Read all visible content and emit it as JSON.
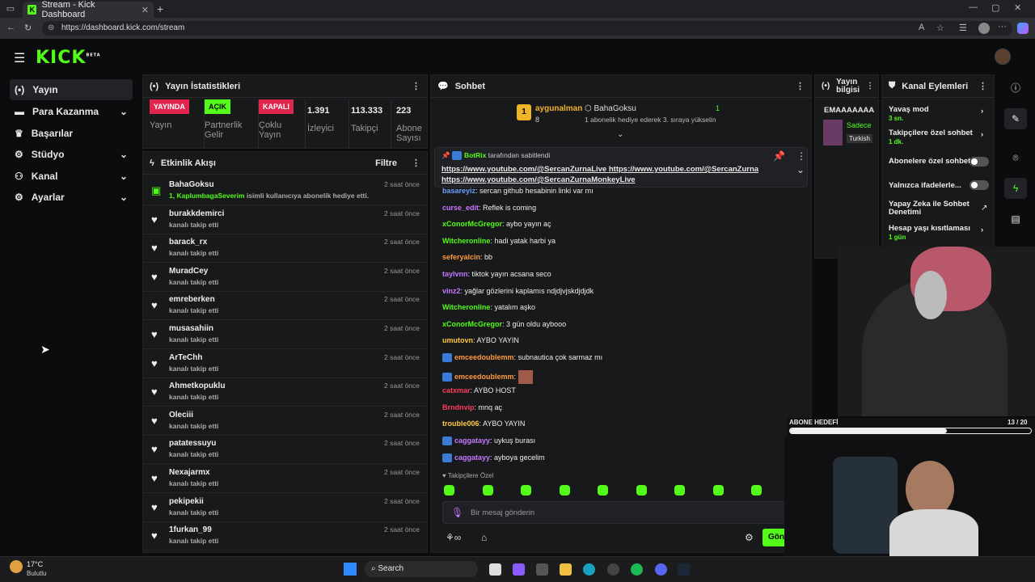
{
  "browser": {
    "tab_title": "Stream - Kick Dashboard",
    "url": "https://dashboard.kick.com/stream"
  },
  "logo": {
    "text": "KICK",
    "beta": "BETA"
  },
  "sidebar": {
    "items": [
      {
        "label": "Yayın",
        "icon": "stream-icon",
        "active": true
      },
      {
        "label": "Para Kazanma",
        "icon": "money-icon",
        "chevron": true
      },
      {
        "label": "Başarılar",
        "icon": "trophy-icon"
      },
      {
        "label": "Stüdyo",
        "icon": "gear-icon",
        "chevron": true
      },
      {
        "label": "Kanal",
        "icon": "users-icon",
        "chevron": true
      },
      {
        "label": "Ayarlar",
        "icon": "settings-icon",
        "chevron": true
      }
    ]
  },
  "stats": {
    "title": "Yayın İstatistikleri",
    "items": [
      {
        "pill": "YAYINDA",
        "label": "Yayın"
      },
      {
        "pill": "AÇIK",
        "label": "Partnerlik Gelir"
      },
      {
        "pill": "KAPALI",
        "label": "Çoklu Yayın"
      },
      {
        "value": "1.391",
        "label": "İzleyici"
      },
      {
        "value": "113.333",
        "label": "Takipçi"
      },
      {
        "value": "223",
        "label": "Abone Sayısı"
      }
    ]
  },
  "activity": {
    "title": "Etkinlik Akışı",
    "filter": "Filtre",
    "rows": [
      {
        "name": "BahaGoksu",
        "prefix": "1, KaplumbagaSeverim",
        "sub": " isimli kullanıcıya abonelik hediye etti.",
        "time": "2 saat önce",
        "gift": true
      },
      {
        "name": "burakkdemirci",
        "sub": "kanalı takip etti",
        "time": "2 saat önce"
      },
      {
        "name": "barack_rx",
        "sub": "kanalı takip etti",
        "time": "2 saat önce"
      },
      {
        "name": "MuradCey",
        "sub": "kanalı takip etti",
        "time": "2 saat önce"
      },
      {
        "name": "emreberken",
        "sub": "kanalı takip etti",
        "time": "2 saat önce"
      },
      {
        "name": "musasahiin",
        "sub": "kanalı takip etti",
        "time": "2 saat önce"
      },
      {
        "name": "ArTeChh",
        "sub": "kanalı takip etti",
        "time": "2 saat önce"
      },
      {
        "name": "Ahmetkopuklu",
        "sub": "kanalı takip etti",
        "time": "2 saat önce"
      },
      {
        "name": "Oleciii",
        "sub": "kanalı takip etti",
        "time": "2 saat önce"
      },
      {
        "name": "patatessuyu",
        "sub": "kanalı takip etti",
        "time": "2 saat önce"
      },
      {
        "name": "Nexajarmx",
        "sub": "kanalı takip etti",
        "time": "2 saat önce"
      },
      {
        "name": "pekipekii",
        "sub": "kanalı takip etti",
        "time": "2 saat önce"
      },
      {
        "name": "1furkan_99",
        "sub": "kanalı takip etti",
        "time": "2 saat önce"
      }
    ]
  },
  "chat": {
    "title": "Sohbet",
    "top_gifter": {
      "rank": "1",
      "name": "aygunalman",
      "count": "8"
    },
    "gifter2": {
      "name": "BahaGoksu",
      "count": "1",
      "note": "1 abonelik hediye ederek 3. sıraya yükselin"
    },
    "pinned": {
      "by": "BotRix",
      "by_suffix": "tarafından sabitlendi",
      "line1a": "https://www.youtube.com/@SercanZurnaLive",
      "line1b": "https://www.youtube.com/@SercanZurna",
      "line2": "https://www.youtube.com/@SercanZurnaMonkeyLive"
    },
    "messages": [
      {
        "user": "basareyiz",
        "color": "#6aa0ff",
        "text": "sercan github hesabinin linki var mı"
      },
      {
        "user": "curse_edit",
        "color": "#c678ff",
        "text": "Reflek is coming"
      },
      {
        "user": "xConorMcGregor",
        "color": "#53fc18",
        "text": "aybo yayın aç"
      },
      {
        "user": "Witcheronline",
        "color": "#53fc18",
        "text": "hadi yatak harbi ya"
      },
      {
        "user": "seferyalcin",
        "color": "#ff9a3c",
        "text": "bb"
      },
      {
        "user": "taylvnn",
        "color": "#c678ff",
        "text": "tiktok yayın acsana seco"
      },
      {
        "user": "vinz2",
        "color": "#c678ff",
        "text": "yağlar gözlerini kaplamıs ndjdjvjskdjdjdk"
      },
      {
        "user": "Witcheronline",
        "color": "#53fc18",
        "text": "yatalım aşko"
      },
      {
        "user": "xConorMcGregor",
        "color": "#53fc18",
        "text": "3 gün oldu aybooo"
      },
      {
        "user": "umutovn",
        "color": "#ffc93c",
        "text": "AYBO YAYIN"
      },
      {
        "user": "emceedoublemm",
        "color": "#ff9a3c",
        "text": "subnautica çok sarmaz mı",
        "badge": true
      },
      {
        "user": "emceedoublemm",
        "color": "#ff9a3c",
        "text": "",
        "badge": true,
        "emote": true
      },
      {
        "user": "catxmar",
        "color": "#ff3b5c",
        "text": "AYBO HOST"
      },
      {
        "user": "Brndnvip",
        "color": "#ff3b5c",
        "text": "mnq aç"
      },
      {
        "user": "trouble006",
        "color": "#ffc93c",
        "text": "AYBO YAYIN"
      },
      {
        "user": "caggatayy",
        "color": "#c678ff",
        "text": "uykuş burası",
        "badge": true
      },
      {
        "user": "caggatayy",
        "color": "#c678ff",
        "text": "ayboya gecelim",
        "badge": true
      }
    ],
    "followers_only": "Takipçilere Özel",
    "input_placeholder": "Bir mesaj gönderin",
    "send": "Gönder"
  },
  "stream_info": {
    "title": "Yayın bilgisi",
    "stream_title": "EMAAAAAAA",
    "category_a": "Sadece",
    "category_b": "Turkish"
  },
  "channel_actions": {
    "title": "Kanal Eylemleri",
    "items": [
      {
        "label": "Yavaş mod",
        "value": "3 sn.",
        "type": "arrow"
      },
      {
        "label": "Takipçilere özel sohbet",
        "value": "1 dk.",
        "type": "arrow"
      },
      {
        "label": "Abonelere özel sohbet",
        "type": "toggle"
      },
      {
        "label": "Yalnızca ifadelerle...",
        "type": "toggle"
      },
      {
        "label": "Yapay Zeka ile Sohbet Denetimi",
        "type": "external"
      },
      {
        "label": "Hesap yaşı kısıtlaması",
        "value": "1 gün",
        "type": "arrow"
      }
    ]
  },
  "sub_goal": {
    "label": "ABONE HEDEFİ",
    "progress": "13 / 20",
    "fraction": 0.65
  },
  "taskbar": {
    "weather_temp": "17°C",
    "weather_desc": "Bulutlu",
    "search": "Search"
  }
}
